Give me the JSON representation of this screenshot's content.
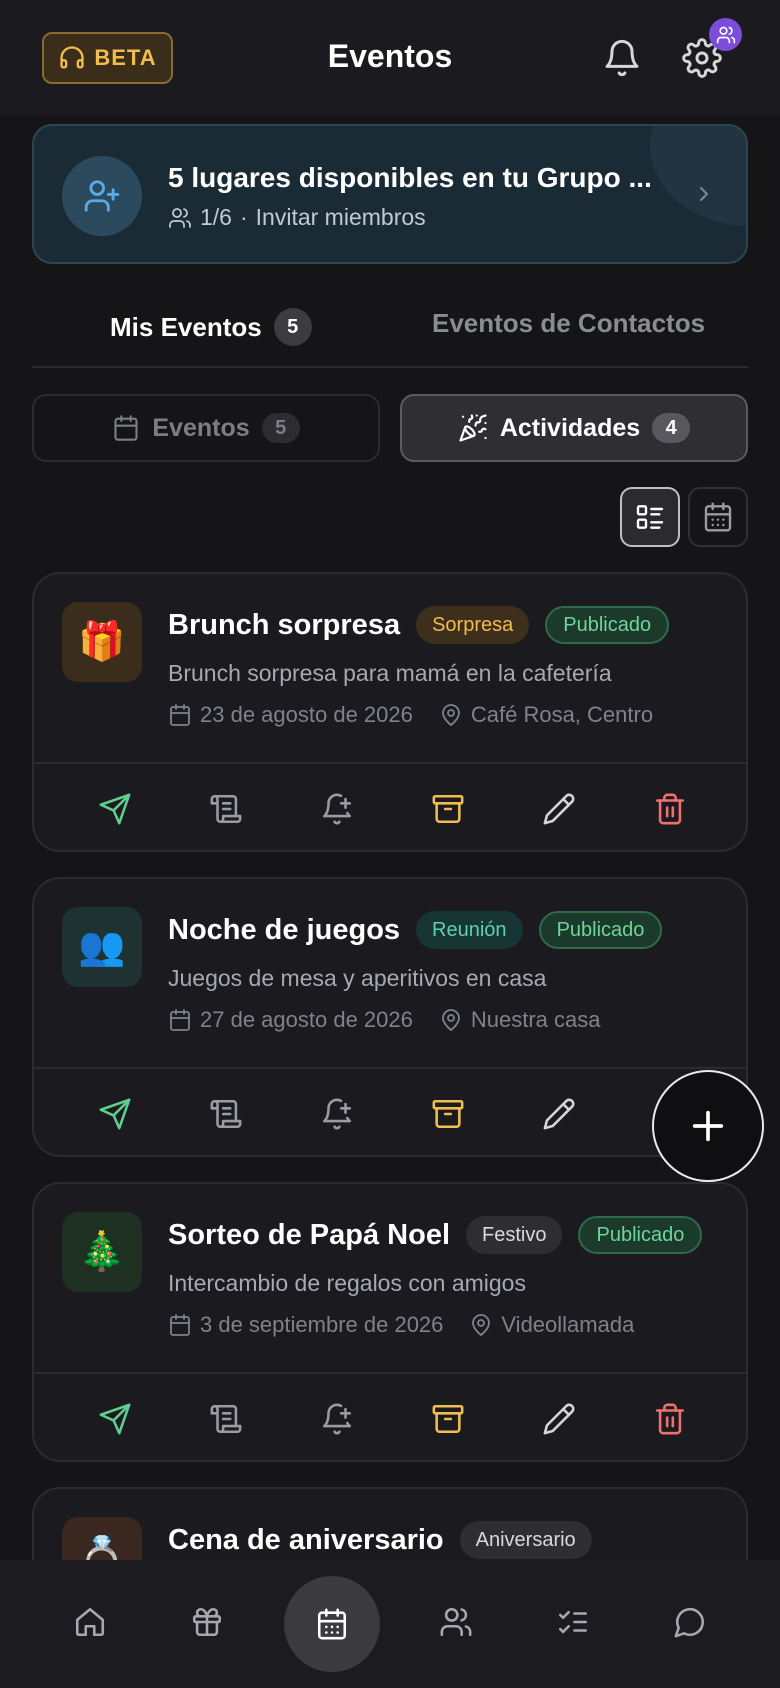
{
  "header": {
    "beta_label": "BETA",
    "title": "Eventos"
  },
  "group_banner": {
    "title": "5 lugares disponibles en tu Grupo ...",
    "members": "1/6",
    "separator": "·",
    "invite": "Invitar miembros"
  },
  "tabs": {
    "mine_label": "Mis Eventos",
    "mine_count": "5",
    "contacts_label": "Eventos de Contactos"
  },
  "segments": {
    "events_label": "Eventos",
    "events_count": "5",
    "activities_label": "Actividades",
    "activities_count": "4"
  },
  "events": [
    {
      "emoji": "🎁",
      "name": "Brunch sorpresa",
      "tag": "Sorpresa",
      "status": "Publicado",
      "description": "Brunch sorpresa para mamá en la cafetería",
      "date": "23 de agosto de 2026",
      "location": "Café Rosa, Centro"
    },
    {
      "emoji": "👥",
      "name": "Noche de juegos",
      "tag": "Reunión",
      "status": "Publicado",
      "description": "Juegos de mesa y aperitivos en casa",
      "date": "27 de agosto de 2026",
      "location": "Nuestra casa"
    },
    {
      "emoji": "🎄",
      "name": "Sorteo de Papá Noel",
      "tag": "Festivo",
      "status": "Publicado",
      "description": "Intercambio de regalos con amigos",
      "date": "3 de septiembre de 2026",
      "location": "Videollamada"
    },
    {
      "emoji": "💍",
      "name": "Cena de aniversario",
      "tag": "Aniversario"
    }
  ],
  "colors": {
    "send": "#5fcf8f",
    "archive": "#f1bd4e",
    "delete": "#f07070",
    "badge": "#7c4ddb"
  }
}
